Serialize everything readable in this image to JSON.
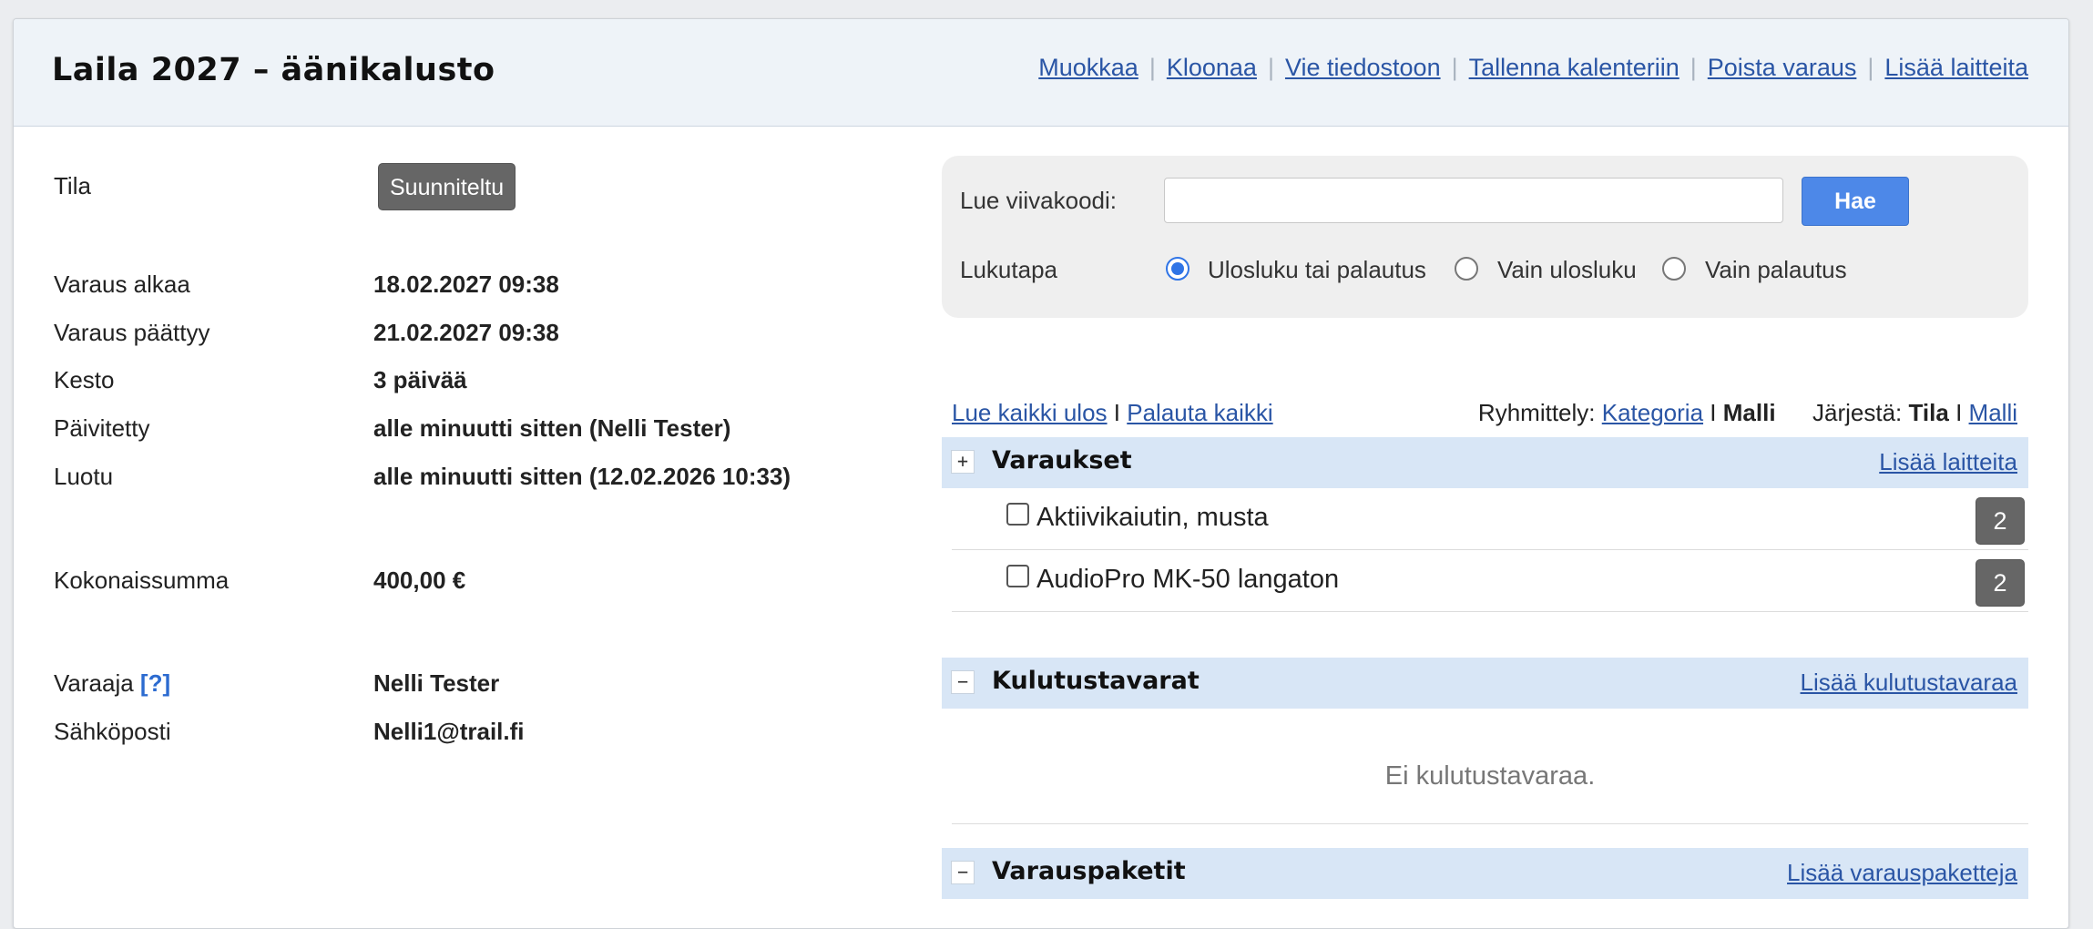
{
  "header": {
    "title": "Laila 2027 – äänikalusto",
    "actions": [
      "Muokkaa",
      "Kloonaa",
      "Vie tiedostoon",
      "Tallenna kalenteriin",
      "Poista varaus",
      "Lisää laitteita"
    ]
  },
  "details": {
    "status_label": "Tila",
    "status_value": "Suunniteltu",
    "start_label": "Varaus alkaa",
    "start_value": "18.02.2027 09:38",
    "end_label": "Varaus päättyy",
    "end_value": "21.02.2027 09:38",
    "duration_label": "Kesto",
    "duration_value": "3 päivää",
    "updated_label": "Päivitetty",
    "updated_value": "alle minuutti sitten (Nelli Tester)",
    "created_label": "Luotu",
    "created_value": "alle minuutti sitten (12.02.2026 10:33)",
    "total_label": "Kokonaissumma",
    "total_value": "400,00 €",
    "booker_label": "Varaaja",
    "booker_help": "[?]",
    "booker_value": "Nelli Tester",
    "email_label": "Sähköposti",
    "email_value": "Nelli1@trail.fi"
  },
  "scan": {
    "barcode_label": "Lue viivakoodi:",
    "barcode_value": "",
    "search_button": "Hae",
    "mode_label": "Lukutapa",
    "modes": [
      "Ulosluku tai palautus",
      "Vain ulosluku",
      "Vain palautus"
    ],
    "selected_mode": "Ulosluku tai palautus"
  },
  "toolbar": {
    "check_out_all": "Lue kaikki ulos",
    "separator": "I",
    "return_all": "Palauta kaikki",
    "grouping_label": "Ryhmittely:",
    "grouping_category": "Kategoria",
    "grouping_model": "Malli",
    "sort_label": "Järjestä:",
    "sort_status": "Tila",
    "sort_model": "Malli"
  },
  "reservations": {
    "toggle": "+",
    "title": "Varaukset",
    "action": "Lisää laitteita",
    "items": [
      {
        "name": "Aktiivikaiutin, musta",
        "count": "2"
      },
      {
        "name": "AudioPro MK-50 langaton",
        "count": "2"
      }
    ]
  },
  "consumables": {
    "toggle": "−",
    "title": "Kulutustavarat",
    "action": "Lisää kulutustavaraa",
    "empty": "Ei kulutustavaraa."
  },
  "packages": {
    "toggle": "−",
    "title": "Varauspaketit",
    "action": "Lisää varauspaketteja"
  },
  "colors": {
    "link": "#2a55a5",
    "primary_button": "#4d88e8",
    "section_bar": "#d8e6f6",
    "badge": "#666666"
  }
}
